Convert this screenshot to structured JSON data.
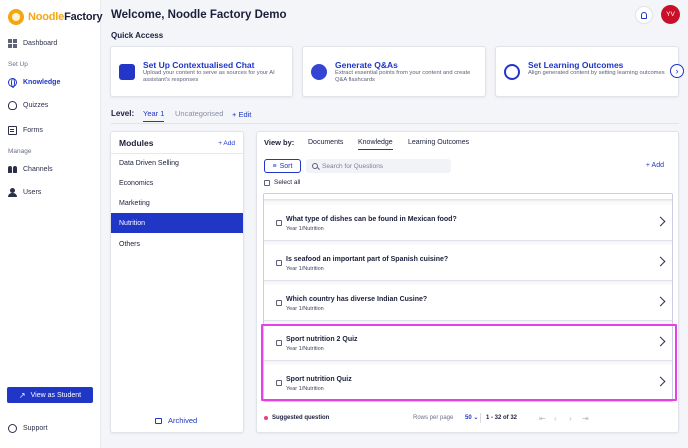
{
  "brand": {
    "name_part1": "Noodle",
    "name_part2": "Factory"
  },
  "sidebar": {
    "items": [
      {
        "label": "Dashboard",
        "icon": "grid-icon"
      },
      {
        "label": "Knowledge",
        "icon": "globe-icon"
      },
      {
        "label": "Quizzes",
        "icon": "bulb-icon"
      },
      {
        "label": "Forms",
        "icon": "form-icon"
      },
      {
        "label": "Channels",
        "icon": "people-icon"
      },
      {
        "label": "Users",
        "icon": "user-icon"
      }
    ],
    "section_setup": "Set Up",
    "section_manage": "Manage",
    "view_as_student": "View as Student",
    "support": "Support"
  },
  "header": {
    "welcome": "Welcome, Noodle Factory Demo",
    "avatar_initials": "YV"
  },
  "quick_access": {
    "title": "Quick Access",
    "cards": [
      {
        "title": "Set Up Contextualised Chat",
        "desc": "Upload your content to serve as sources for your AI assistant's responses"
      },
      {
        "title": "Generate Q&As",
        "desc": "Extract essential points from your content and create Q&A flashcards"
      },
      {
        "title": "Set Learning Outcomes",
        "desc": "Align generated content by setting learning outcomes"
      }
    ]
  },
  "level": {
    "label": "Level:",
    "tabs": [
      "Year 1",
      "Uncategorised"
    ],
    "edit": "+ Edit"
  },
  "modules": {
    "title": "Modules",
    "add": "+ Add",
    "items": [
      "Data Driven Selling",
      "Economics",
      "Marketing",
      "Nutrition",
      "Others"
    ],
    "active_index": 3,
    "archived": "Archived"
  },
  "questions": {
    "view_by_label": "View by:",
    "view_tabs": [
      "Documents",
      "Knowledge",
      "Learning Outcomes"
    ],
    "active_view": 1,
    "sort": "Sort",
    "search_placeholder": "Search for Questions",
    "add": "+ Add",
    "select_all": "Select all",
    "rows": [
      {
        "text": "What type of dishes can be found in Mexican food?",
        "tag": "Year 1/Nutrition"
      },
      {
        "text": "Is seafood an important part of Spanish cuisine?",
        "tag": "Year 1/Nutrition"
      },
      {
        "text": "Which country has diverse Indian Cusine?",
        "tag": "Year 1/Nutrition"
      },
      {
        "text": "Sport nutrition 2 Quiz",
        "tag": "Year 1/Nutrition"
      },
      {
        "text": "Sport nutrition Quiz",
        "tag": "Year 1/Nutrition"
      }
    ],
    "suggested": "Suggested question",
    "rows_per_page_label": "Rows per page",
    "rows_per_page_value": "50",
    "range": "1 - 32 of 32"
  },
  "colors": {
    "accent": "#1f36c7",
    "brand_orange": "#f3a712",
    "avatar": "#c9102b",
    "highlight": "#e640e6"
  }
}
